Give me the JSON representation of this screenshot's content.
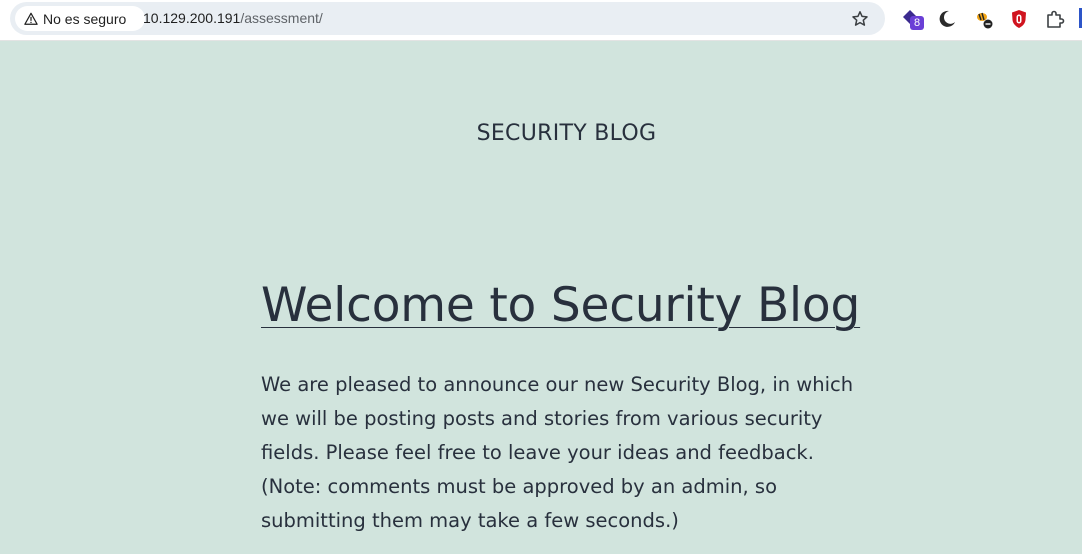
{
  "browser": {
    "security_label": "No es seguro",
    "url_host": "10.129.200.191",
    "url_path": "/assessment/",
    "extension_badge": "8"
  },
  "site": {
    "title": "SECURITY BLOG"
  },
  "post": {
    "title": "Welcome to Security Blog",
    "body": "We are pleased to announce our new Security Blog, in which we will be posting posts and stories from various security fields. Please feel free to leave your ideas and feedback. (Note: comments must be approved by an admin, so submitting them may take a few seconds.)"
  },
  "colors": {
    "page_background": "#d1e4dd",
    "text": "#28303d",
    "omnibox": "#e9eef3",
    "badge": "#6a3fd6",
    "adblock": "#d0141f"
  },
  "icons": [
    "warning-icon",
    "bookmark-star-icon",
    "extension-badge-icon",
    "dark-mode-icon",
    "bee-extension-icon",
    "shield-extension-icon",
    "extensions-puzzle-icon"
  ]
}
